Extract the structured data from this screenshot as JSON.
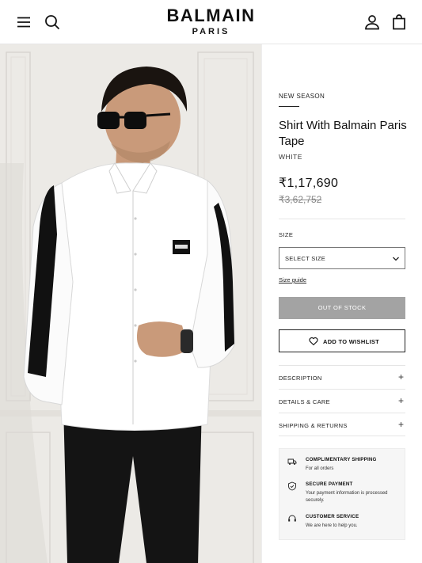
{
  "header": {
    "brand_name": "BALMAIN",
    "brand_sub": "PARIS",
    "icons": {
      "menu": "menu-icon",
      "search": "search-icon",
      "account": "user-icon",
      "bag": "shopping-bag-icon"
    }
  },
  "product": {
    "eyebrow": "NEW SEASON",
    "title": "Shirt With Balmain Paris Tape",
    "color": "WHITE",
    "price": "₹1,17,690",
    "old_price": "₹3,62,752",
    "size_label": "SIZE",
    "size_select": "SELECT SIZE",
    "size_guide": "Size guide",
    "out_of_stock": "OUT OF STOCK",
    "wishlist": "ADD TO WISHLIST"
  },
  "accordion": [
    {
      "label": "DESCRIPTION"
    },
    {
      "label": "DETAILS & CARE"
    },
    {
      "label": "SHIPPING & RETURNS"
    }
  ],
  "info": [
    {
      "title": "COMPLIMENTARY SHIPPING",
      "desc": "For all orders",
      "icon": "truck-icon"
    },
    {
      "title": "SECURE PAYMENT",
      "desc": "Your payment information is processed securely.",
      "icon": "shield-icon"
    },
    {
      "title": "CUSTOMER SERVICE",
      "desc": "We are here to help you.",
      "icon": "headset-icon"
    }
  ],
  "colors": {
    "button_disabled": "#a3a3a3",
    "text": "#111111",
    "muted": "#888888"
  }
}
